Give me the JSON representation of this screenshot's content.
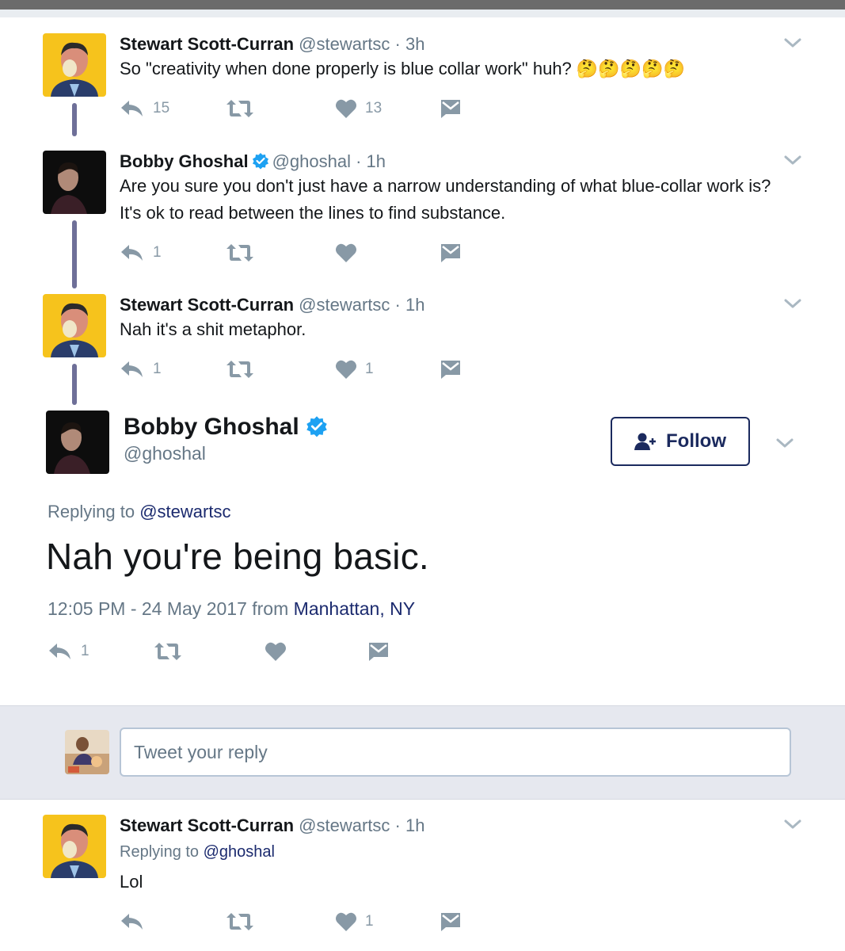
{
  "thread": [
    {
      "name": "Stewart Scott-Curran",
      "handle": "@stewartsc",
      "time": "3h",
      "verified": false,
      "text": "So \"creativity when done properly is blue collar work\" huh? 🤔🤔🤔🤔🤔",
      "reply_count": "15",
      "retweet_count": "",
      "like_count": "13"
    },
    {
      "name": "Bobby Ghoshal",
      "handle": "@ghoshal",
      "time": "1h",
      "verified": true,
      "text": "Are you sure you don't just have a narrow understanding of what blue-collar work is? It's ok to read between the lines to find substance.",
      "reply_count": "1",
      "retweet_count": "",
      "like_count": ""
    },
    {
      "name": "Stewart Scott-Curran",
      "handle": "@stewartsc",
      "time": "1h",
      "verified": false,
      "text": "Nah it's a shit metaphor.",
      "reply_count": "1",
      "retweet_count": "",
      "like_count": "1"
    }
  ],
  "main": {
    "name": "Bobby Ghoshal",
    "handle": "@ghoshal",
    "verified": true,
    "follow_label": "Follow",
    "replying_prefix": "Replying to",
    "replying_to": "@stewartsc",
    "text": "Nah you're being basic.",
    "timestamp": "12:05 PM - 24 May 2017 from",
    "location": "Manhattan, NY",
    "reply_count": "1",
    "retweet_count": "",
    "like_count": ""
  },
  "reply_box": {
    "placeholder": "Tweet your reply"
  },
  "replies": [
    {
      "name": "Stewart Scott-Curran",
      "handle": "@stewartsc",
      "time": "1h",
      "replying_prefix": "Replying to",
      "replying_to": "@ghoshal",
      "text": "Lol",
      "reply_count": "",
      "retweet_count": "",
      "like_count": "1"
    }
  ],
  "separator": "·",
  "colors": {
    "accent_dark_blue": "#1b2a5e",
    "verified_blue": "#1da1f2",
    "icon_gray": "#8899a6",
    "thread_line": "#6e6f98",
    "stewart_avatar_bg": "#f6c31c"
  },
  "icons": [
    "reply-icon",
    "retweet-icon",
    "like-icon",
    "dm-icon",
    "chevron-down-icon",
    "verified-icon",
    "follow-user-icon"
  ]
}
